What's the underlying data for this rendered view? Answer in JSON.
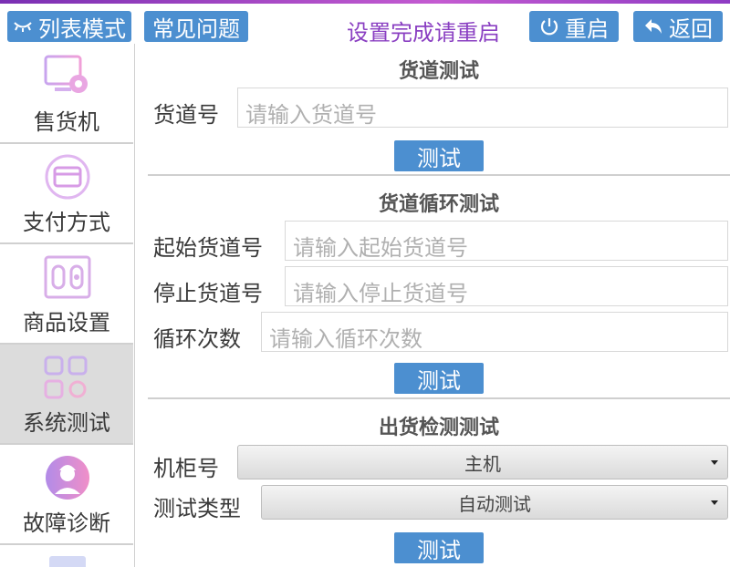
{
  "header": {
    "list_mode": "列表模式",
    "faq": "常见问题",
    "hint": "设置完成请重启",
    "restart": "重启",
    "back": "返回"
  },
  "sidebar": {
    "items": [
      {
        "label": "售货机",
        "icon": "vending-machine-settings-icon"
      },
      {
        "label": "支付方式",
        "icon": "card-payment-icon"
      },
      {
        "label": "商品设置",
        "icon": "product-slots-icon"
      },
      {
        "label": "系统测试",
        "icon": "system-test-grid-icon",
        "active": true
      },
      {
        "label": "故障诊断",
        "icon": "engineer-avatar-icon"
      }
    ]
  },
  "slot_test": {
    "title": "货道测试",
    "slot_label": "货道号",
    "slot_placeholder": "请输入货道号",
    "button": "测试"
  },
  "cycle_test": {
    "title": "货道循环测试",
    "start_label": "起始货道号",
    "start_placeholder": "请输入起始货道号",
    "stop_label": "停止货道号",
    "stop_placeholder": "请输入停止货道号",
    "count_label": "循环次数",
    "count_placeholder": "请输入循环次数",
    "button": "测试"
  },
  "dispense_test": {
    "title": "出货检测测试",
    "cabinet_label": "机柜号",
    "cabinet_value": "主机",
    "type_label": "测试类型",
    "type_value": "自动测试",
    "button": "测试"
  },
  "colors": {
    "accent_blue": "#4c8fd0",
    "hint_purple": "#8a3fc2",
    "active_item_bg": "#dcdcdc"
  }
}
